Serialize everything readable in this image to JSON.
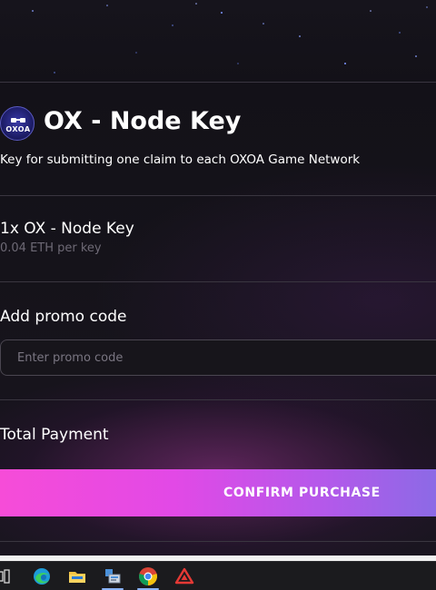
{
  "product": {
    "logo_text": "OXOA",
    "title": "OX - Node Key",
    "description": "Key for submitting one claim to each OXOA Game Network"
  },
  "order": {
    "item": "1x OX - Node Key",
    "price": "0.04 ETH per key"
  },
  "promo": {
    "label": "Add promo code",
    "placeholder": "Enter promo code",
    "value": ""
  },
  "total": {
    "label": "Total Payment"
  },
  "actions": {
    "confirm_label": "CONFIRM PURCHASE"
  },
  "taskbar": {
    "items": [
      "task-view-icon",
      "edge-icon",
      "file-explorer-icon",
      "network-app-icon",
      "chrome-icon",
      "red-triangle-app-icon"
    ]
  },
  "colors": {
    "accent_start": "#f64cd8",
    "accent_end": "#8c6ae6",
    "muted_text": "#6e6a76"
  }
}
